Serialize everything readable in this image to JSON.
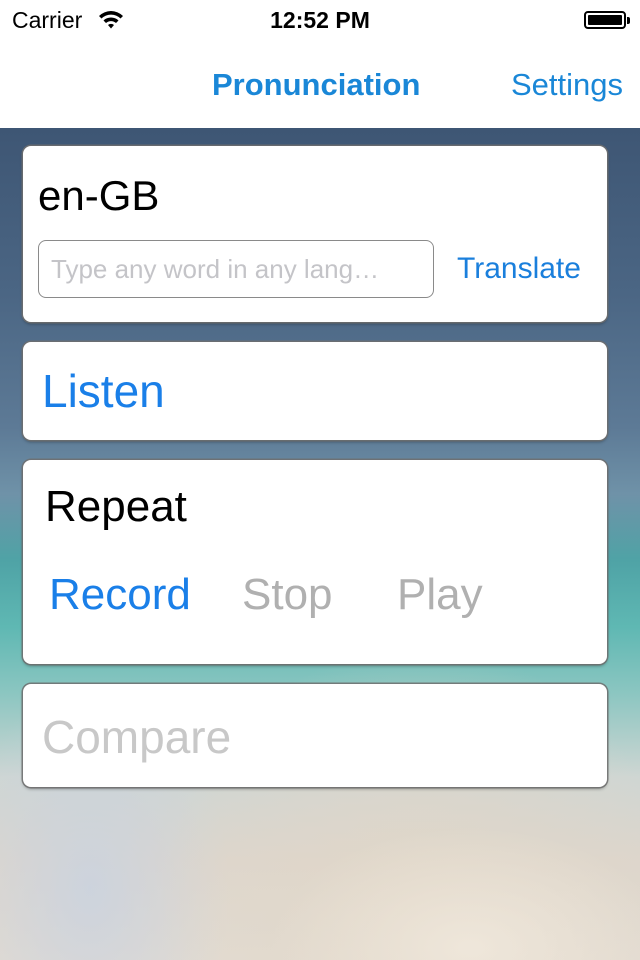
{
  "status_bar": {
    "carrier": "Carrier",
    "wifi_icon": "wifi-icon",
    "time": "12:52 PM",
    "battery_icon": "battery-full-icon"
  },
  "nav": {
    "title": "Pronunciation",
    "settings_label": "Settings"
  },
  "language_card": {
    "language": "en-GB",
    "input_value": "",
    "input_placeholder": "Type any word in any lang…",
    "translate_label": "Translate"
  },
  "listen_card": {
    "listen_label": "Listen"
  },
  "repeat_card": {
    "title": "Repeat",
    "record_label": "Record",
    "stop_label": "Stop",
    "play_label": "Play"
  },
  "compare_card": {
    "compare_label": "Compare"
  },
  "colors": {
    "accent": "#1a7fe8",
    "disabled": "#b0b0b0"
  }
}
